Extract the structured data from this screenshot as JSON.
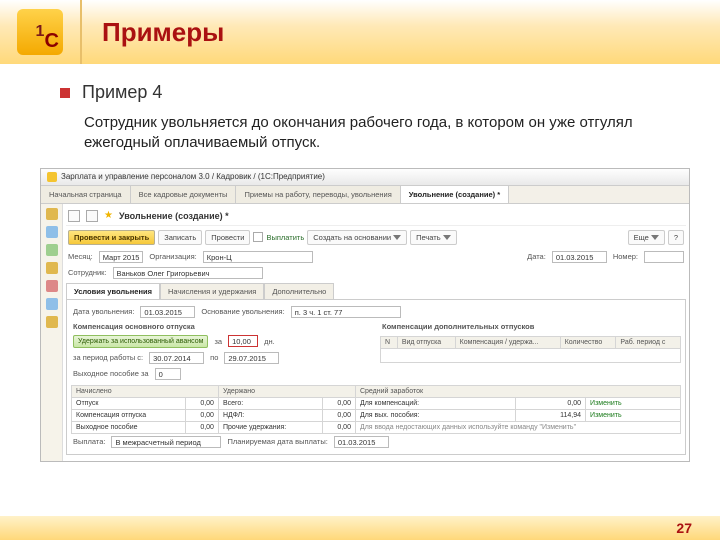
{
  "slide": {
    "title": "Примеры",
    "example_label": "Пример 4",
    "description": "Сотрудник увольняется до окончания рабочего года, в котором он уже отгулял ежегодный оплачиваемый отпуск.",
    "page": "27"
  },
  "app": {
    "window_title": "Зарплата и управление персоналом 3.0 / Кадровик / (1С:Предприятие)",
    "tabs": {
      "t0": "Начальная страница",
      "t1": "Все кадровые документы",
      "t2": "Приемы на работу, переводы, увольнения",
      "t3": "Увольнение (создание) *"
    },
    "doc_title": "Увольнение (создание) *",
    "toolbar": {
      "post_close": "Провести и закрыть",
      "write": "Записать",
      "post": "Провести",
      "pay": "Выплатить",
      "create_from": "Создать на основании",
      "print": "Печать",
      "more": "Еще"
    },
    "fields": {
      "month_lbl": "Месяц:",
      "month_val": "Март 2015",
      "org_lbl": "Организация:",
      "org_val": "Крон-Ц",
      "date_lbl": "Дата:",
      "date_val": "01.03.2015",
      "num_lbl": "Номер:",
      "emp_lbl": "Сотрудник:",
      "emp_val": "Ваньков Олег Григорьевич",
      "subtabs": {
        "a": "Условия увольнения",
        "b": "Начисления и удержания",
        "c": "Дополнительно"
      },
      "fire_date_lbl": "Дата увольнения:",
      "fire_date_val": "01.03.2015",
      "ground_lbl": "Основание увольнения:",
      "ground_val": "п. 3 ч. 1 ст. 77",
      "comp_title": "Компенсация основного отпуска",
      "comp_btn": "Удержать за использованный авансом",
      "days_val": "10,00",
      "days_lbl": "дн.",
      "period_lbl": "за период работы с:",
      "period_from": "30.07.2014",
      "period_to_lbl": "по",
      "period_to": "29.07.2015",
      "right_title": "Компенсации дополнительных отпусков",
      "tbl_h1": "N",
      "tbl_h2": "Вид отпуска",
      "tbl_h3": "Компенсация / удержа...",
      "tbl_h4": "Количество",
      "tbl_h5": "Раб. период с",
      "sev_lbl": "Выходное пособие за",
      "sev_val": "0",
      "grid_h1": "Начислено",
      "grid_h2": "Удержано",
      "grid_h3": "Средний заработок",
      "r1c1": "Отпуск",
      "r1c2": "0,00",
      "r1c3": "Всего:",
      "r1c4": "0,00",
      "r1c5": "Для компенсаций:",
      "r1c6": "0,00",
      "r1c7": "Изменить",
      "r2c1": "Компенсация отпуска",
      "r2c2": "0,00",
      "r2c3": "НДФЛ:",
      "r2c4": "0,00",
      "r2c5": "Для вых. пособия:",
      "r2c6": "114,94",
      "r2c7": "Изменить",
      "r3c1": "Выходное пособие",
      "r3c2": "0,00",
      "r3c3": "Прочие удержания:",
      "r3c4": "0,00",
      "hint": "Для ввода недостающих данных используйте команду \"Изменить\"",
      "pay_lbl": "Выплата:",
      "pay_val": "В межрасчетный период",
      "plan_lbl": "Планируемая дата выплаты:",
      "plan_val": "01.03.2015"
    }
  }
}
